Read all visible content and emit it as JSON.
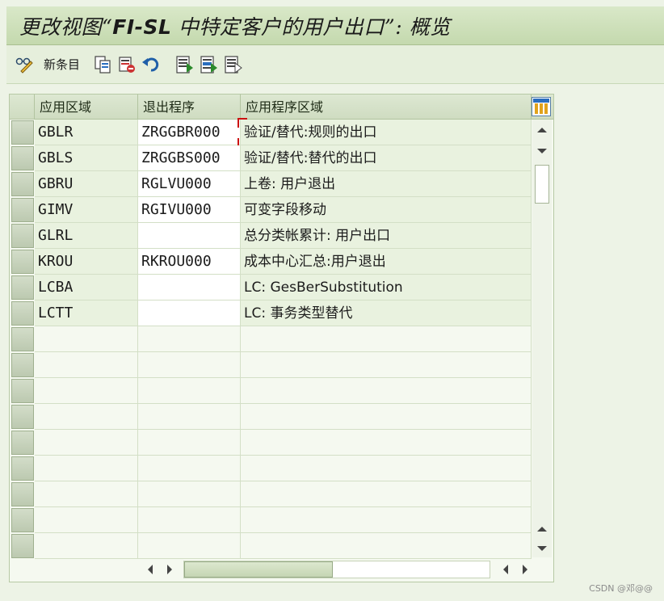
{
  "window": {
    "title_prefix": "更改视图“",
    "title_bold": "FI-SL",
    "title_suffix": " 中特定客户的用户出口”: 概览"
  },
  "toolbar": {
    "new_entries_label": "新条目",
    "icons": [
      "display-change-icon",
      "copy-icon",
      "delete-icon",
      "undo-icon",
      "select-all-icon",
      "select-block-icon",
      "deselect-all-icon"
    ]
  },
  "table": {
    "headers": [
      "应用区域",
      "退出程序",
      "应用程序区域"
    ],
    "rows": [
      {
        "area": "GBLR",
        "exit": "ZRGGBR000",
        "desc": "验证/替代:规则的出口"
      },
      {
        "area": "GBLS",
        "exit": "ZRGGBS000",
        "desc": "验证/替代:替代的出口"
      },
      {
        "area": "GBRU",
        "exit": "RGLVU000",
        "desc": "上卷: 用户退出"
      },
      {
        "area": "GIMV",
        "exit": "RGIVU000",
        "desc": "可变字段移动"
      },
      {
        "area": "GLRL",
        "exit": "",
        "desc": "总分类帐累计: 用户出口"
      },
      {
        "area": "KROU",
        "exit": "RKROU000",
        "desc": "成本中心汇总:用户退出"
      },
      {
        "area": "LCBA",
        "exit": "",
        "desc": "LC: GesBerSubstitution"
      },
      {
        "area": "LCTT",
        "exit": "",
        "desc": "LC: 事务类型替代"
      }
    ],
    "empty_rows": 9
  },
  "colors": {
    "title_bg": "#c4d9ae",
    "background": "#edf3e6",
    "cursor_frame": "#cc1111"
  },
  "footer": {
    "watermark": "CSDN @邓@@"
  }
}
